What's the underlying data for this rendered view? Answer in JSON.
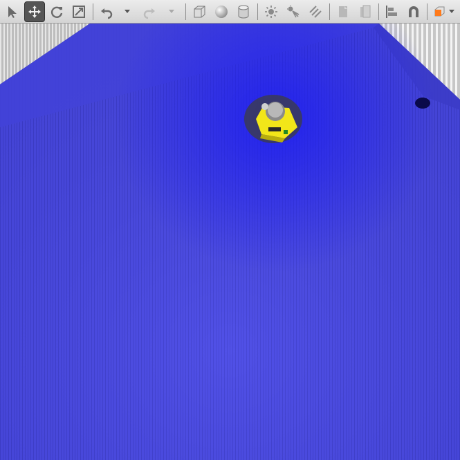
{
  "toolbar": {
    "tools": [
      {
        "name": "select-mode",
        "icon": "arrow-cursor-icon",
        "active": false
      },
      {
        "name": "translate-mode",
        "icon": "move-arrows-icon",
        "active": true
      },
      {
        "name": "rotate-mode",
        "icon": "rotate-icon",
        "active": false
      },
      {
        "name": "scale-mode",
        "icon": "scale-icon",
        "active": false
      },
      {
        "name": "undo",
        "icon": "undo-icon",
        "enabled": true
      },
      {
        "name": "redo",
        "icon": "redo-icon",
        "enabled": false
      },
      {
        "name": "box-shape",
        "icon": "box-icon"
      },
      {
        "name": "sphere-shape",
        "icon": "sphere-icon"
      },
      {
        "name": "cylinder-shape",
        "icon": "cylinder-icon"
      },
      {
        "name": "point-light",
        "icon": "point-light-icon"
      },
      {
        "name": "spot-light",
        "icon": "spot-light-icon"
      },
      {
        "name": "directional-light",
        "icon": "directional-light-icon"
      },
      {
        "name": "copy",
        "icon": "copy-icon",
        "enabled": false
      },
      {
        "name": "paste",
        "icon": "paste-icon",
        "enabled": false
      },
      {
        "name": "align",
        "icon": "align-icon"
      },
      {
        "name": "snap",
        "icon": "magnet-icon"
      },
      {
        "name": "view-angle",
        "icon": "view-cube-icon"
      }
    ]
  },
  "scene": {
    "floor_color": "#4a4ae0",
    "wall_color": "#c8c8c8",
    "robot_color": "#f2e619",
    "accent_color": "#ff7a1a"
  }
}
